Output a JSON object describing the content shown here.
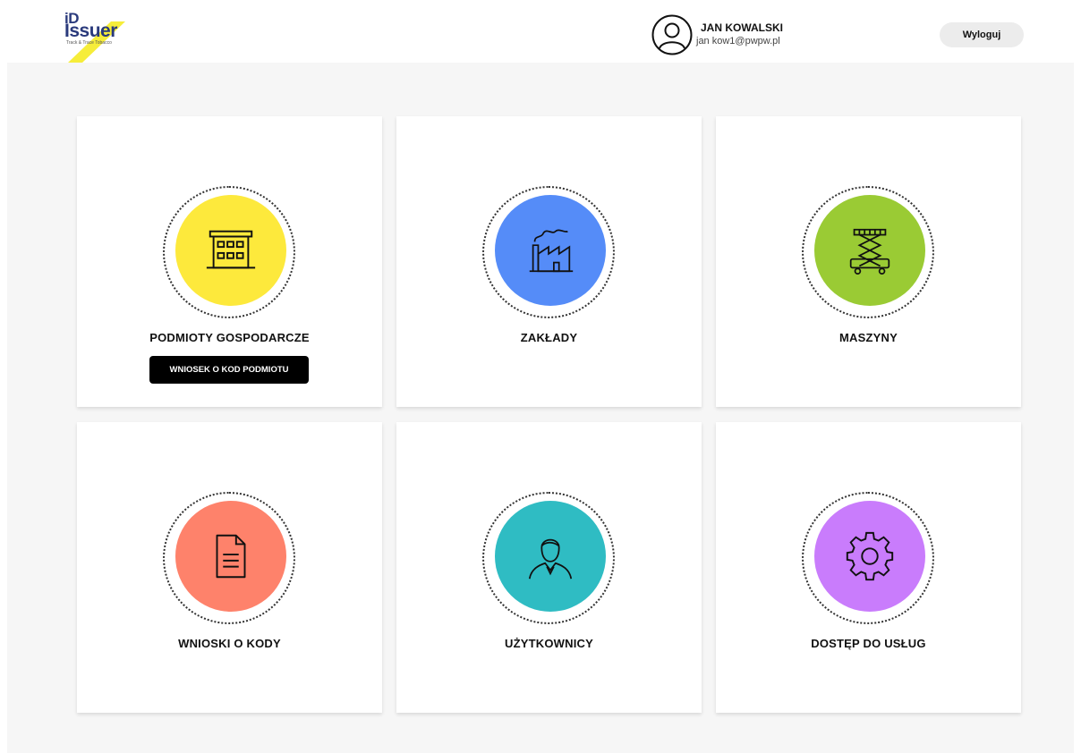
{
  "header": {
    "logo": {
      "word": "Issuer",
      "prefix": "iD",
      "tagline": "Track & Trace Tobacco"
    },
    "user": {
      "name": "JAN KOWALSKI",
      "email": "jan kow1@pwpw.pl"
    },
    "logout_label": "Wyloguj"
  },
  "colors": {
    "yellow": "#fde93c",
    "blue": "#558cf8",
    "green": "#9acb34",
    "salmon": "#fe826b",
    "teal": "#2fbcc3",
    "purple": "#c97cfc",
    "accent": "#f6ed3a"
  },
  "cards": [
    {
      "title": "PODMIOTY GOSPODARCZE",
      "icon": "building-icon",
      "color": "#fde93c",
      "button_label": "WNIOSEK O KOD PODMIOTU"
    },
    {
      "title": "ZAKŁADY",
      "icon": "factory-icon",
      "color": "#558cf8"
    },
    {
      "title": "MASZYNY",
      "icon": "scissor-lift-icon",
      "color": "#9acb34"
    },
    {
      "title": "WNIOSKI O KODY",
      "icon": "document-icon",
      "color": "#fe826b"
    },
    {
      "title": "UŻYTKOWNICY",
      "icon": "user-icon",
      "color": "#2fbcc3"
    },
    {
      "title": "DOSTĘP DO USŁUG",
      "icon": "gear-icon",
      "color": "#c97cfc"
    }
  ]
}
